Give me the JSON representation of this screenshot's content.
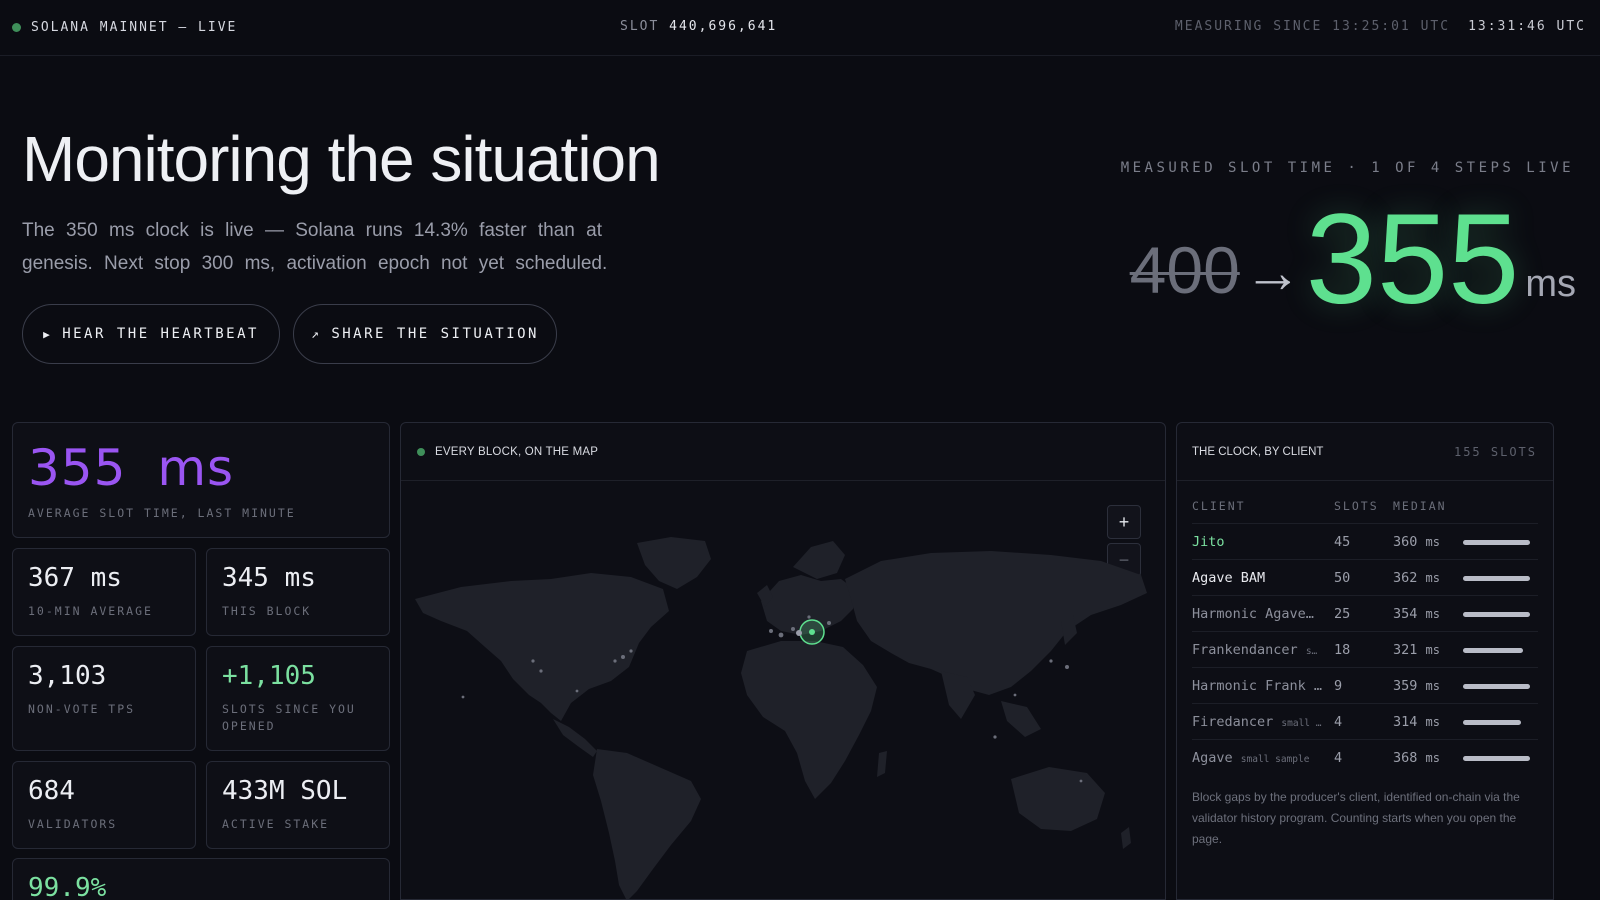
{
  "topbar": {
    "network": "SOLANA MAINNET — LIVE",
    "slot_label": "SLOT",
    "slot_value": "440,696,641",
    "measuring_since": "MEASURING SINCE 13:25:01 UTC",
    "clock": "13:31:46 UTC",
    "live_color": "#3f8f5a"
  },
  "hero": {
    "title": "Monitoring the situation",
    "subtitle": "The 350 ms clock is live — Solana runs 14.3% faster than at genesis. Next stop 300 ms, activation epoch not yet scheduled.",
    "buttons": [
      {
        "icon": "play-icon",
        "glyph": "▶",
        "label": "HEAR THE HEARTBEAT"
      },
      {
        "icon": "share-arrow-icon",
        "glyph": "↗",
        "label": "SHARE THE SITUATION"
      }
    ],
    "measured_label": "MEASURED SLOT TIME · 1 OF 4 STEPS LIVE",
    "old_value": "400",
    "arrow": "→",
    "new_value": "355",
    "unit": "ms",
    "accent": "#5ee08f"
  },
  "stats": {
    "avg_slot": {
      "value": "355 ms",
      "label": "AVERAGE SLOT TIME, LAST MINUTE",
      "color": "#9a55f2"
    },
    "cards": [
      {
        "value": "367 ms",
        "label": "10-MIN AVERAGE"
      },
      {
        "value": "345 ms",
        "label": "THIS BLOCK"
      },
      {
        "value": "3,103",
        "label": "NON-VOTE TPS"
      },
      {
        "value": "+1,105",
        "label": "SLOTS SINCE YOU OPENED"
      },
      {
        "value": "684",
        "label": "VALIDATORS"
      },
      {
        "value": "433M SOL",
        "label": "ACTIVE STAKE"
      }
    ],
    "partial_value": "99.9%"
  },
  "map": {
    "title": "EVERY BLOCK, ON THE MAP",
    "zoom_in": "+",
    "zoom_out": "−"
  },
  "clients": {
    "title": "THE CLOCK, BY CLIENT",
    "slot_count": "155 SLOTS",
    "headers": {
      "client": "CLIENT",
      "slots": "SLOTS",
      "median": "MEDIAN"
    },
    "rows": [
      {
        "name": "Jito",
        "tag": "",
        "slots": "45",
        "median": "360",
        "unit": "ms",
        "bar": 1.0,
        "highlight": "#7be0a0"
      },
      {
        "name": "Agave BAM",
        "tag": "",
        "slots": "50",
        "median": "362",
        "unit": "ms",
        "bar": 1.0,
        "highlight": "#e8e9ee"
      },
      {
        "name": "Harmonic Agave…",
        "tag": "",
        "slots": "25",
        "median": "354",
        "unit": "ms",
        "bar": 1.0
      },
      {
        "name": "Frankendancer",
        "tag": "s…",
        "slots": "18",
        "median": "321",
        "unit": "ms",
        "bar": 0.89
      },
      {
        "name": "Harmonic Frank …",
        "tag": "",
        "slots": "9",
        "median": "359",
        "unit": "ms",
        "bar": 1.0
      },
      {
        "name": "Firedancer",
        "tag": "small …",
        "slots": "4",
        "median": "314",
        "unit": "ms",
        "bar": 0.87
      },
      {
        "name": "Agave",
        "tag": "small sample",
        "slots": "4",
        "median": "368",
        "unit": "ms",
        "bar": 1.0
      }
    ],
    "footnote": "Block gaps by the producer's client, identified on-chain via the validator history program. Counting starts when you open the page."
  }
}
